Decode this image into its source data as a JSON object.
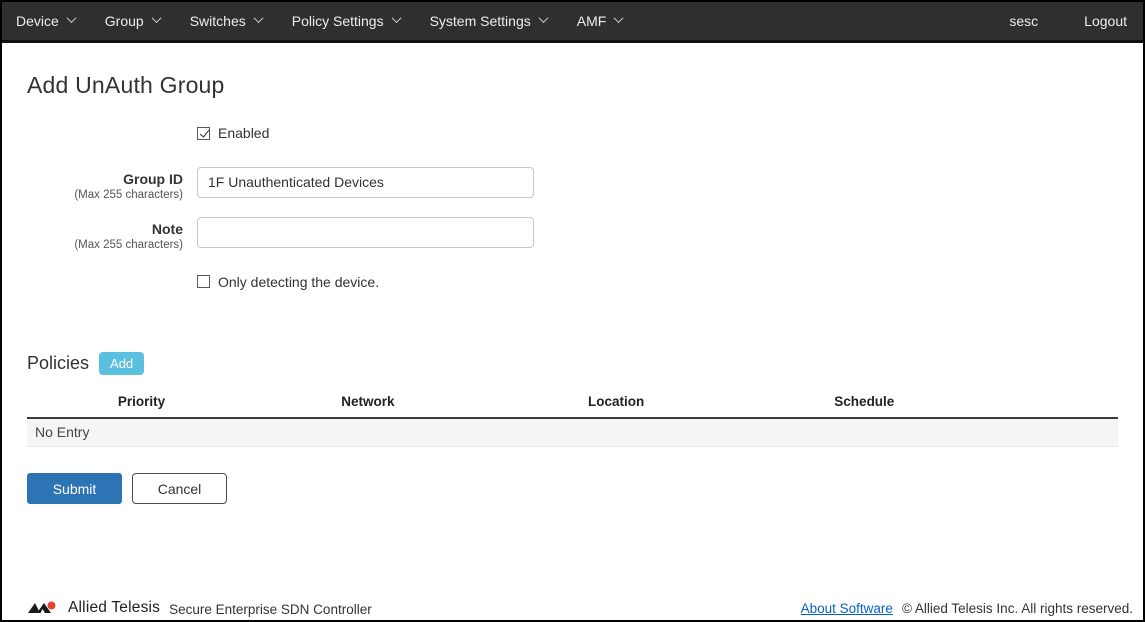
{
  "nav": {
    "items": [
      {
        "label": "Device"
      },
      {
        "label": "Group"
      },
      {
        "label": "Switches"
      },
      {
        "label": "Policy Settings"
      },
      {
        "label": "System Settings"
      },
      {
        "label": "AMF"
      }
    ],
    "username": "sesc",
    "logout_label": "Logout"
  },
  "page": {
    "title": "Add UnAuth Group"
  },
  "form": {
    "enabled_checkbox": {
      "label": "Enabled",
      "checked": true
    },
    "group_id": {
      "label": "Group ID",
      "hint": "(Max 255 characters)",
      "value": "1F Unauthenticated Devices"
    },
    "note": {
      "label": "Note",
      "hint": "(Max 255 characters)",
      "value": ""
    },
    "detect_checkbox": {
      "label": "Only detecting the device.",
      "checked": false
    }
  },
  "policies": {
    "heading": "Policies",
    "add_button_label": "Add",
    "table": {
      "headers": [
        "Priority",
        "Network",
        "Location",
        "Schedule"
      ],
      "empty_text": "No Entry"
    }
  },
  "actions": {
    "submit_label": "Submit",
    "cancel_label": "Cancel"
  },
  "footer": {
    "brand": "Allied Telesis",
    "product": "Secure Enterprise SDN Controller",
    "about_link": "About Software",
    "copyright": "© Allied Telesis Inc. All rights reserved."
  },
  "colors": {
    "nav_background": "#2f2f2f",
    "submit_blue": "#2d74b5",
    "add_button_blue": "#5bc0de",
    "link_blue": "#0563c1",
    "logo_red": "#e8412d",
    "empty_row_gray": "#f5f5f5"
  }
}
